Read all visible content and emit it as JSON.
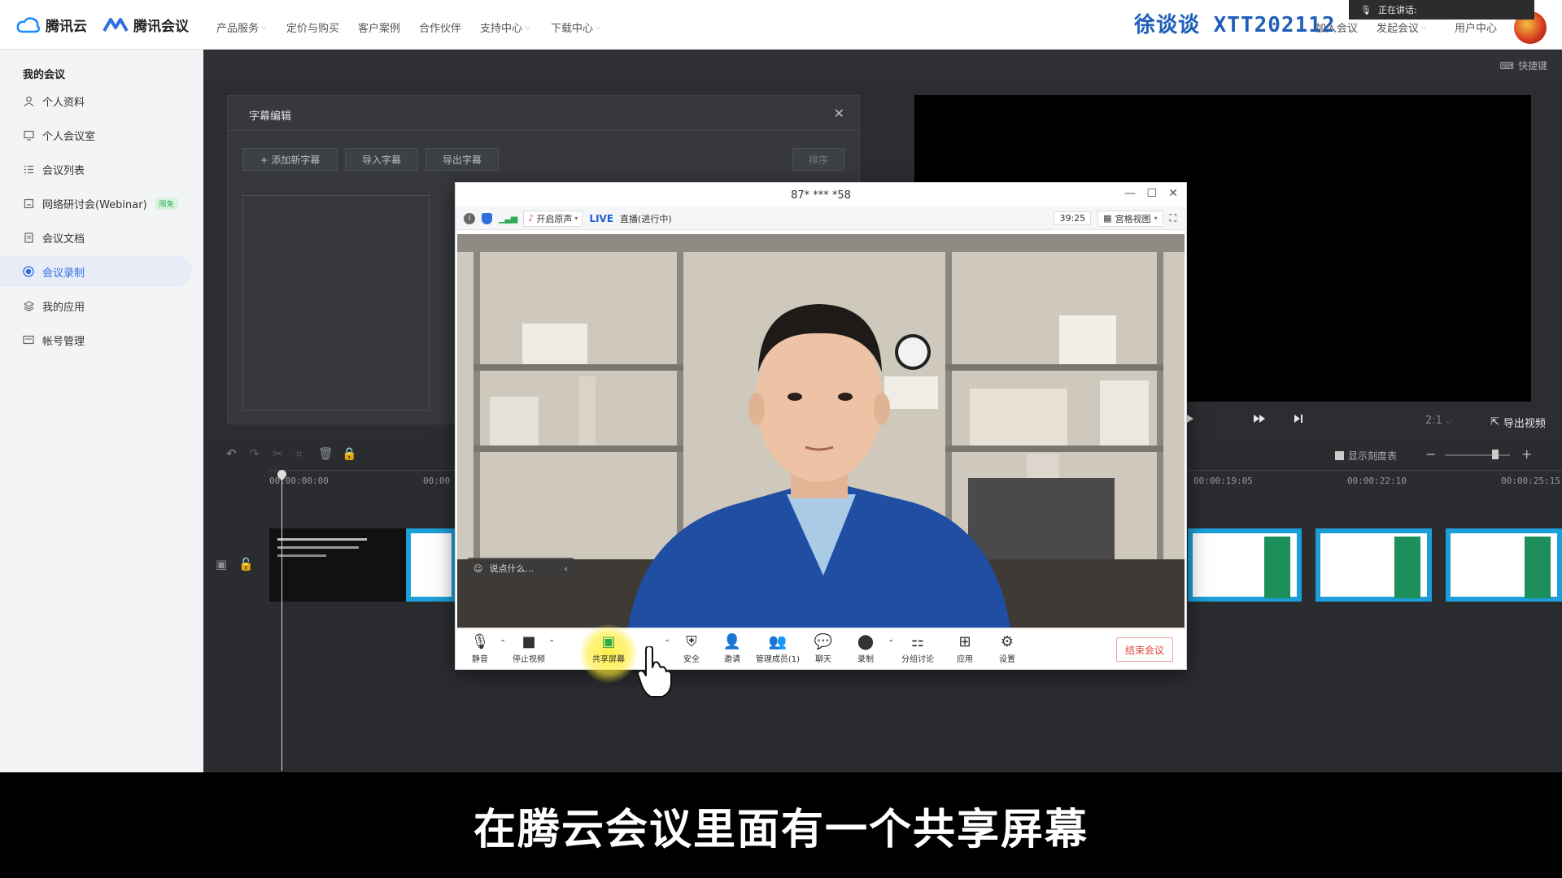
{
  "topbar": {
    "logo_cloud": "腾讯云",
    "logo_meeting": "腾讯会议",
    "nav": [
      "产品服务",
      "定价与购买",
      "客户案例",
      "合作伙伴",
      "支持中心",
      "下载中心"
    ],
    "watermark": "徐谈谈 XTT202112",
    "right_links": [
      "加入会议",
      "发起会议",
      "用户中心"
    ],
    "speaking_label": "正在讲话:"
  },
  "sidebar": {
    "title": "我的会议",
    "items": [
      {
        "label": "个人资料",
        "icon": "user-icon"
      },
      {
        "label": "个人会议室",
        "icon": "monitor-icon"
      },
      {
        "label": "会议列表",
        "icon": "list-icon"
      },
      {
        "label": "网络研讨会(Webinar)",
        "icon": "webinar-icon",
        "badge": "限免"
      },
      {
        "label": "会议文档",
        "icon": "document-icon"
      },
      {
        "label": "会议录制",
        "icon": "record-icon",
        "active": true
      },
      {
        "label": "我的应用",
        "icon": "layers-icon"
      },
      {
        "label": "帐号管理",
        "icon": "id-card-icon"
      }
    ]
  },
  "editor": {
    "shortcut_label": "快捷键",
    "subtitle_panel": {
      "title": "字幕编辑",
      "add_btn": "+ 添加新字幕",
      "import_btn": "导入字幕",
      "export_btn": "导出字幕",
      "sort_btn": "排序"
    },
    "preview": {
      "speed": "2:1",
      "export_video": "导出视频"
    },
    "timeline": {
      "show_scale": "显示刻度表",
      "ticks": [
        "00:00:00:00",
        "00:00",
        "00:00:19:05",
        "00:00:22:10",
        "00:00:25:15"
      ]
    }
  },
  "meeting": {
    "title": "87* *** *58",
    "enable_audio": "开启原声",
    "live": "LIVE",
    "live_status": "直播(进行中)",
    "timer": "39:25",
    "view_mode": "宫格视图",
    "chat_placeholder": "说点什么...",
    "controls": [
      "静音",
      "停止视频",
      "共享屏幕",
      "安全",
      "邀请",
      "管理成员(1)",
      "聊天",
      "录制",
      "分组讨论",
      "应用",
      "设置"
    ],
    "end_button": "结束会议"
  },
  "caption": "在腾云会议里面有一个共享屏幕",
  "colors": {
    "accent": "#2f6fe0",
    "end": "#e0463e",
    "watermark": "#1f5fb8"
  }
}
